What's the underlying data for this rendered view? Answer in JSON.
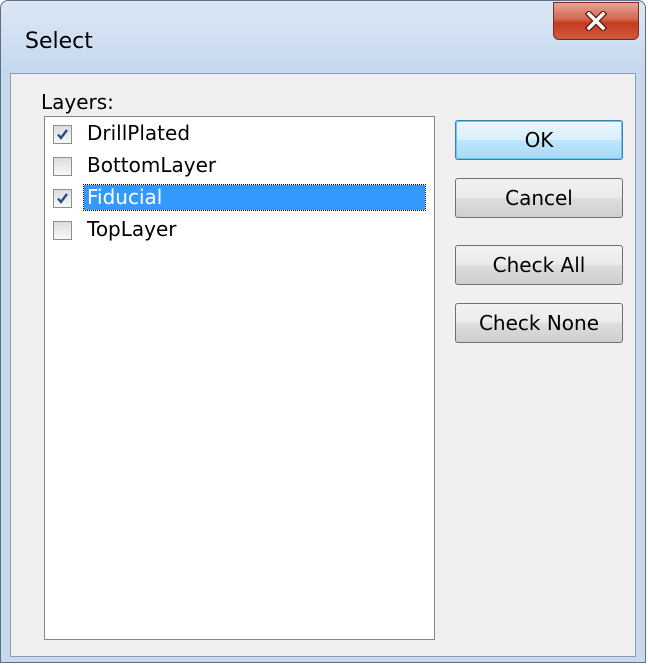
{
  "window": {
    "title": "Select"
  },
  "layers": {
    "label": "Layers:",
    "items": [
      {
        "label": "DrillPlated",
        "checked": true,
        "selected": false
      },
      {
        "label": "BottomLayer",
        "checked": false,
        "selected": false
      },
      {
        "label": "Fiducial",
        "checked": true,
        "selected": true
      },
      {
        "label": "TopLayer",
        "checked": false,
        "selected": false
      }
    ]
  },
  "buttons": {
    "ok": "OK",
    "cancel": "Cancel",
    "check_all": "Check All",
    "check_none": "Check None"
  },
  "icons": {
    "close": "close-icon",
    "check": "checkmark-icon"
  },
  "colors": {
    "selection": "#3399ff",
    "close_button": "#c53a1f",
    "default_button_border": "#3c7fb1"
  }
}
